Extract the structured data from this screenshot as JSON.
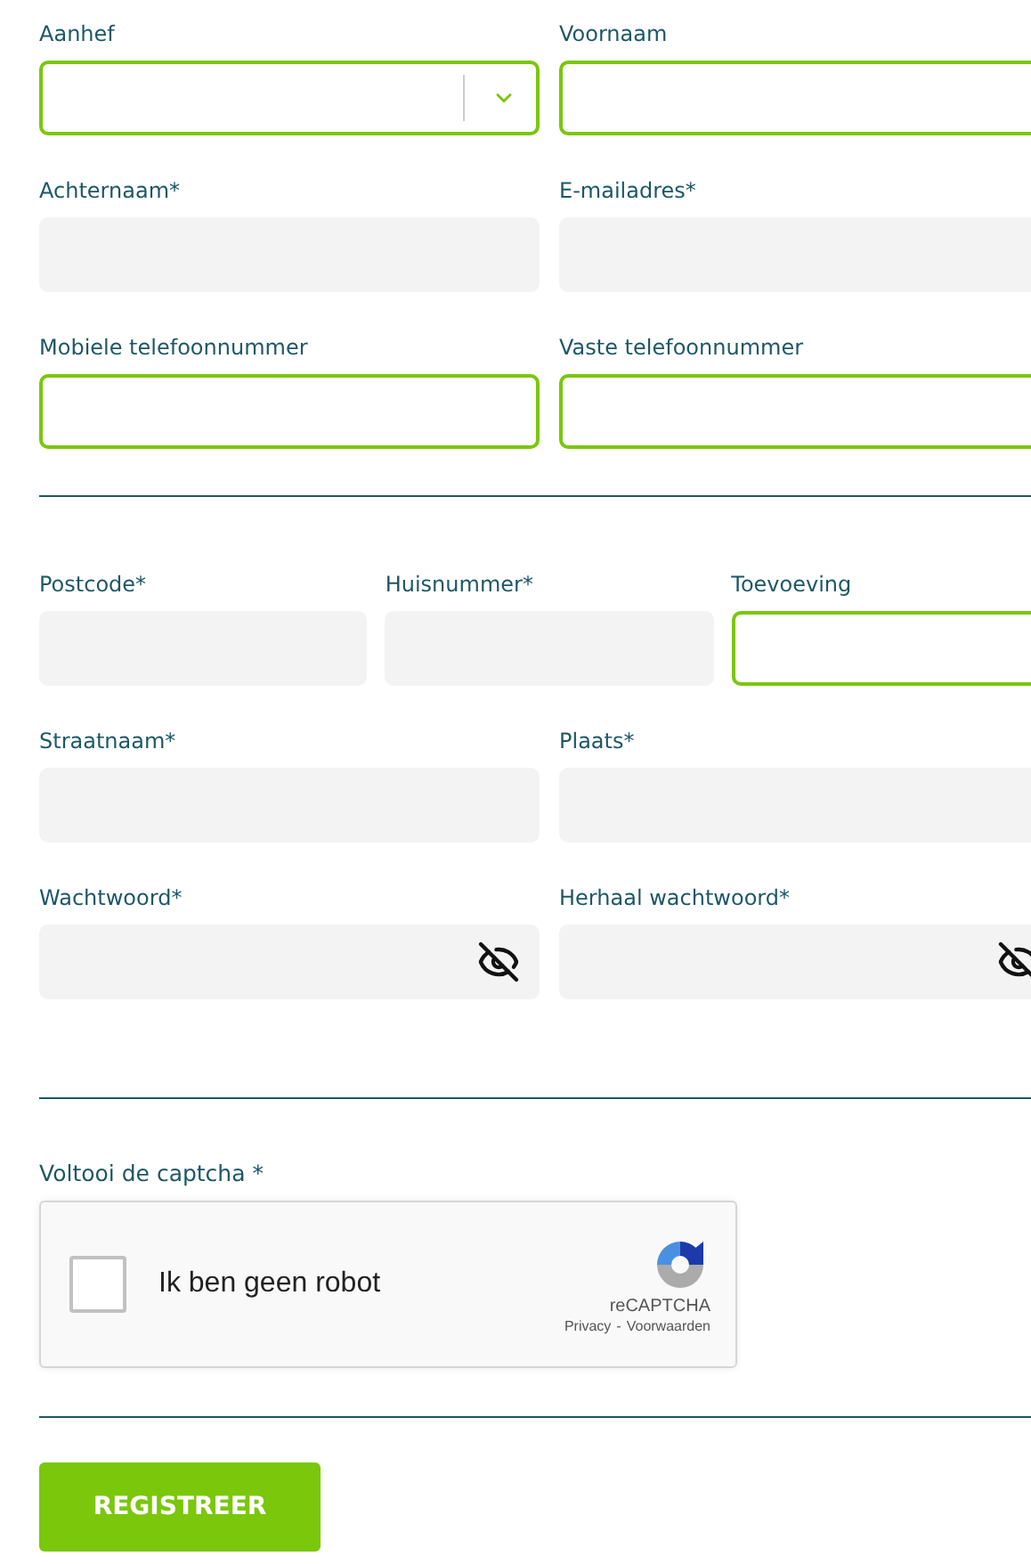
{
  "sections": [
    {
      "rows": [
        [
          {
            "label": "Aanhef",
            "kind": "select",
            "valid": true
          },
          {
            "label": "Voornaam",
            "kind": "text",
            "valid": true
          }
        ],
        [
          {
            "label": "Achternaam*",
            "kind": "text",
            "valid": false
          },
          {
            "label": "E-mailadres*",
            "kind": "text",
            "valid": false
          }
        ],
        [
          {
            "label": "Mobiele telefoonnummer",
            "kind": "text",
            "valid": true
          },
          {
            "label": "Vaste telefoonnummer",
            "kind": "text",
            "valid": true
          }
        ]
      ]
    },
    {
      "rows": [
        [
          {
            "label": "Postcode*",
            "kind": "text",
            "valid": false
          },
          {
            "label": "Huisnummer*",
            "kind": "text",
            "valid": false
          },
          {
            "label": "Toevoeving",
            "kind": "text",
            "valid": true
          }
        ],
        [
          {
            "label": "Straatnaam*",
            "kind": "text",
            "valid": false
          },
          {
            "label": "Plaats*",
            "kind": "text",
            "valid": false
          }
        ],
        [
          {
            "label": "Wachtwoord*",
            "kind": "password",
            "valid": false
          },
          {
            "label": "Herhaal wachtwoord*",
            "kind": "password",
            "valid": false
          }
        ]
      ]
    }
  ],
  "captcha": {
    "label": "Voltooi de captcha *",
    "checked": false,
    "text": "Ik ben geen robot",
    "brand": "reCAPTCHA",
    "privacy": "Privacy",
    "separator": "-",
    "terms": "Voorwaarden"
  },
  "submit": "REGISTREER"
}
